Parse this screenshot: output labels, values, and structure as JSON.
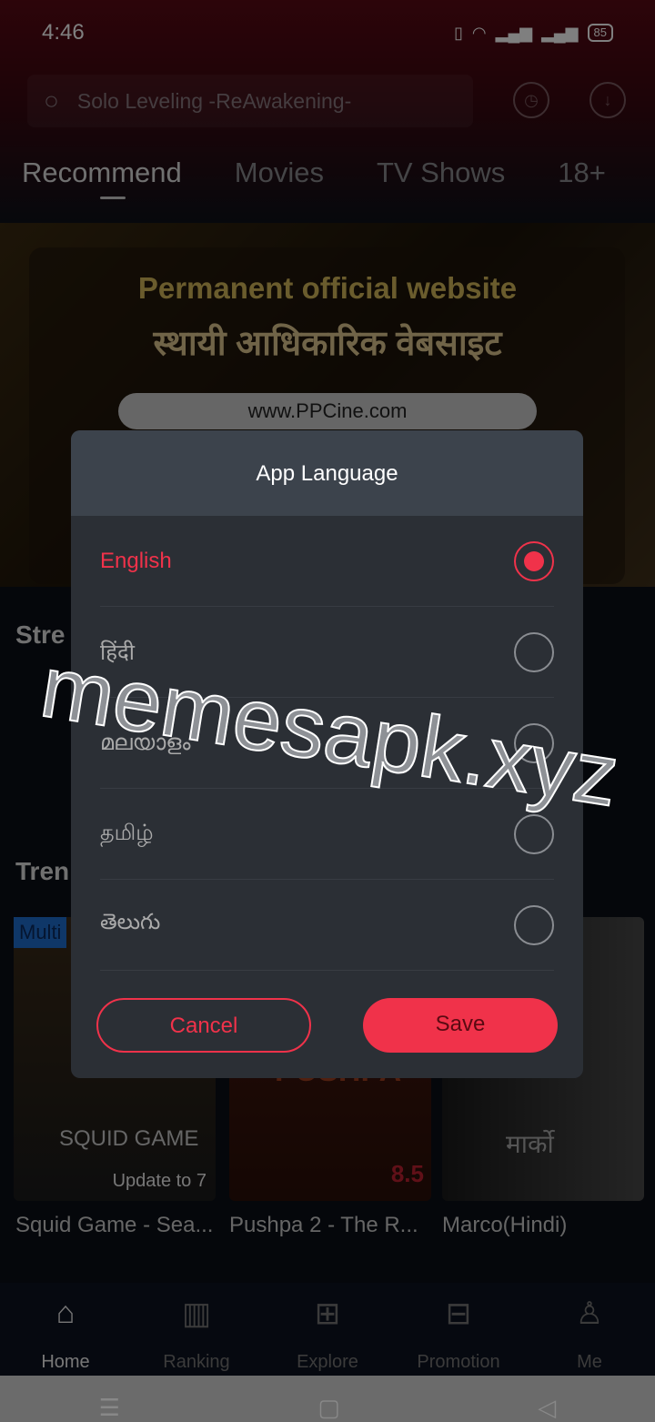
{
  "status": {
    "time": "4:46",
    "battery": "85"
  },
  "search": {
    "placeholder": "Solo Leveling -ReAwakening-"
  },
  "tabs": [
    "Recommend",
    "Movies",
    "TV Shows",
    "18+"
  ],
  "banner": {
    "line1": "Permanent official website",
    "line2": "स्थायी आधिकारिक वेबसाइट",
    "url": "www.PPCine.com"
  },
  "sections": {
    "streaming": "Stre",
    "trending": "Tren",
    "badge": "Multi"
  },
  "posters": [
    {
      "title": "Squid Game - Sea...",
      "update": "Update to 7",
      "logo": "SQUID GAME"
    },
    {
      "title": "Pushpa 2 - The R...",
      "rating": "8.5",
      "logo": "PUSHPA"
    },
    {
      "title": "Marco(Hindi)",
      "logo": "मार्को"
    }
  ],
  "nav": [
    {
      "label": "Home",
      "icon": "home-icon"
    },
    {
      "label": "Ranking",
      "icon": "ranking-icon"
    },
    {
      "label": "Explore",
      "icon": "explore-icon"
    },
    {
      "label": "Promotion",
      "icon": "gift-icon"
    },
    {
      "label": "Me",
      "icon": "user-icon"
    }
  ],
  "dialog": {
    "title": "App Language",
    "options": [
      "English",
      "हिंदी",
      "മലയാളം",
      "தமிழ்",
      "తెలుగు"
    ],
    "selected": "English",
    "cancel": "Cancel",
    "save": "Save"
  },
  "watermark": "memesapk.xyz",
  "colors": {
    "accent": "#f0324a"
  }
}
